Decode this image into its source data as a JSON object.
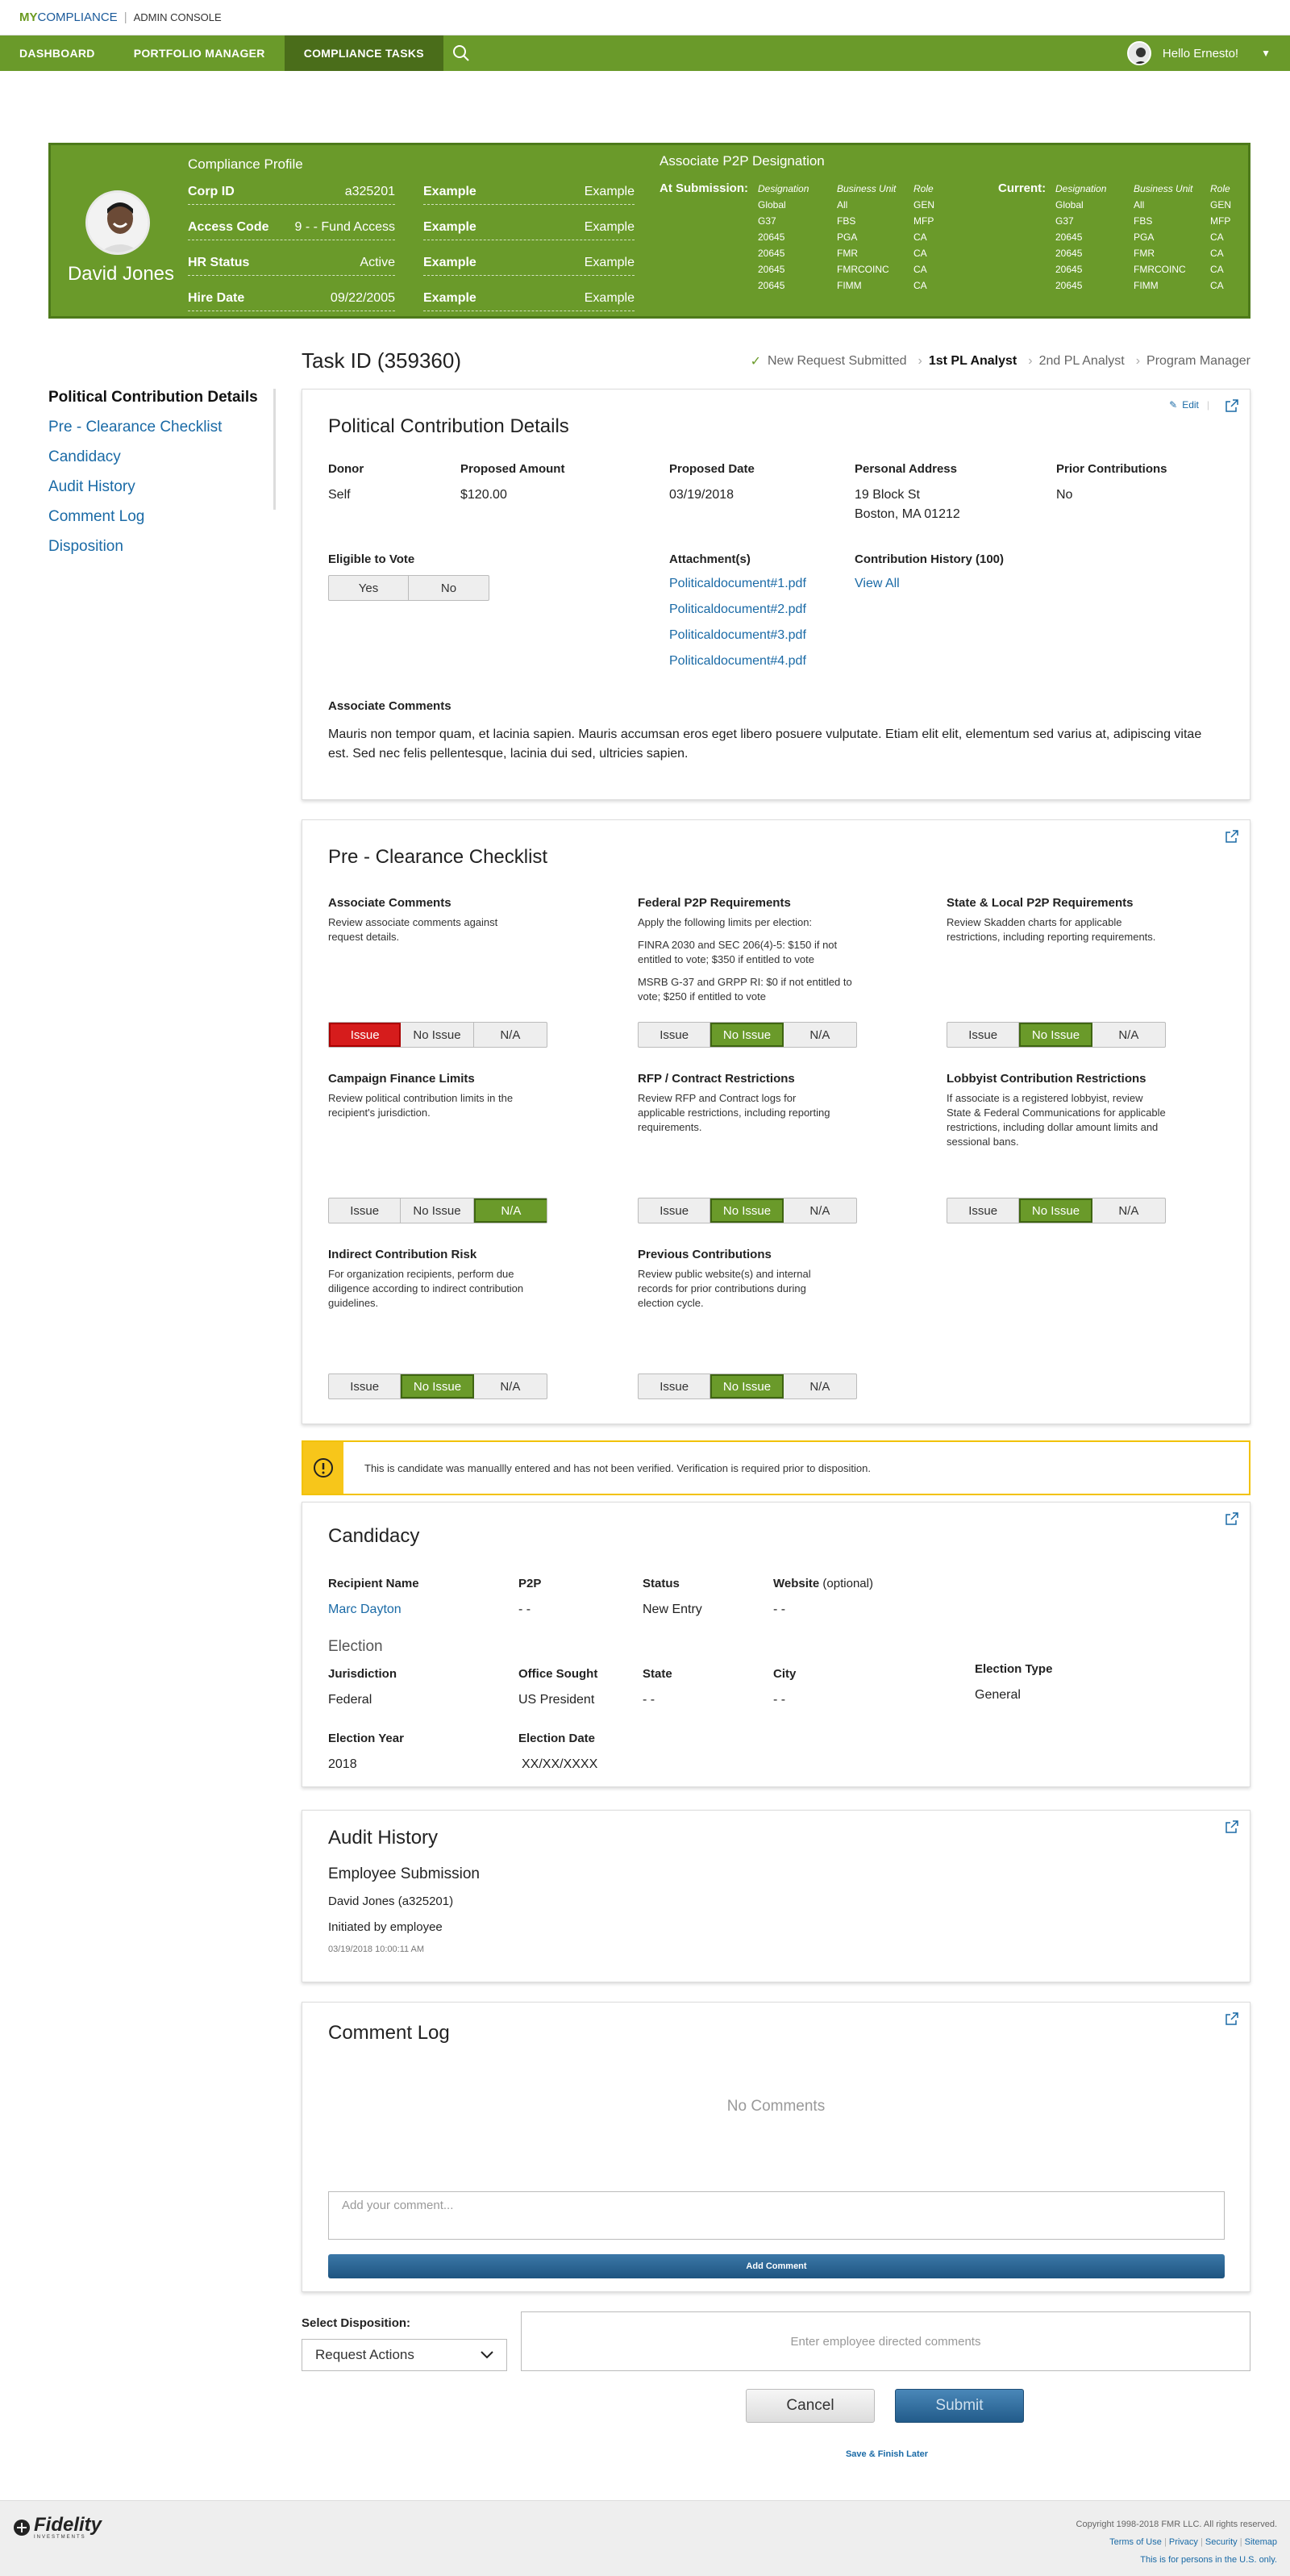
{
  "app": {
    "logo_my": "MY",
    "logo_compliance": "COMPLIANCE",
    "admin_console": "ADMIN CONSOLE"
  },
  "nav": {
    "items": [
      "DASHBOARD",
      "PORTFOLIO MANAGER",
      "COMPLIANCE TASKS"
    ],
    "user_greeting": "Hello Ernesto!"
  },
  "profile": {
    "name": "David Jones",
    "section_title": "Compliance Profile",
    "rows": [
      {
        "label": "Corp ID",
        "value": "a325201",
        "ex_label": "Example",
        "ex_value": "Example"
      },
      {
        "label": "Access Code",
        "value": "9 - - Fund Access",
        "ex_label": "Example",
        "ex_value": "Example"
      },
      {
        "label": "HR Status",
        "value": "Active",
        "ex_label": "Example",
        "ex_value": "Example"
      },
      {
        "label": "Hire Date",
        "value": "09/22/2005",
        "ex_label": "Example",
        "ex_value": "Example"
      }
    ],
    "p2p_title": "Associate P2P Designation",
    "at_submission_label": "At Submission:",
    "current_label": "Current:",
    "col_headers": [
      "Designation",
      "Business Unit",
      "Role"
    ],
    "designation": [
      "Global",
      "G37",
      "20645",
      "20645",
      "20645",
      "20645"
    ],
    "business_unit": [
      "All",
      "FBS",
      "PGA",
      "FMR",
      "FMRCOINC",
      "FIMM"
    ],
    "role": [
      "GEN",
      "MFP",
      "CA",
      "CA",
      "CA",
      "CA"
    ]
  },
  "task": {
    "id": "Task ID (359360)",
    "steps": [
      "New Request Submitted",
      "1st PL Analyst",
      "2nd PL Analyst",
      "Program Manager"
    ]
  },
  "sidenav": [
    "Political Contribution Details",
    "Pre - Clearance Checklist",
    "Candidacy",
    "Audit History",
    "Comment Log",
    "Disposition"
  ],
  "details": {
    "title": "Political Contribution Details",
    "edit": "Edit",
    "donor_label": "Donor",
    "donor": "Self",
    "amount_label": "Proposed Amount",
    "amount": "$120.00",
    "date_label": "Proposed Date",
    "date": "03/19/2018",
    "address_label": "Personal Address",
    "address1": "19 Block St",
    "address2": "Boston, MA 01212",
    "prior_label": "Prior Contributions",
    "prior": "No",
    "eligible_label": "Eligible to Vote",
    "yes": "Yes",
    "no": "No",
    "attachments_label": "Attachment(s)",
    "attachments": [
      "Politicaldocument#1.pdf",
      "Politicaldocument#2.pdf",
      "Politicaldocument#3.pdf",
      "Politicaldocument#4.pdf"
    ],
    "history_label": "Contribution History (100)",
    "view_all": "View All",
    "comments_label": "Associate Comments",
    "comments": "Mauris non tempor quam, et lacinia sapien. Mauris accumsan eros eget libero posuere vulputate. Etiam elit elit, elementum sed varius at, adipiscing vitae est. Sed nec felis pellentesque, lacinia dui sed, ultricies sapien."
  },
  "checklist": {
    "title": "Pre - Clearance Checklist",
    "labels": {
      "issue": "Issue",
      "no_issue": "No Issue",
      "na": "N/A"
    },
    "items": [
      {
        "title": "Associate Comments",
        "desc": "Review associate comments against request details.",
        "state": "issue"
      },
      {
        "title": "Federal P2P Requirements",
        "desc": "Apply the following limits per election:",
        "extra1": "FINRA 2030 and SEC 206(4)-5:  $150 if  not entitled  to vote; $350 if entitled to vote",
        "extra2": "MSRB G-37 and GRPP RI:  $0 if  not entitled  to vote; $250 if entitled to vote",
        "state": "no_issue"
      },
      {
        "title": "State & Local P2P Requirements",
        "desc": "Review Skadden charts for applicable restrictions, including reporting requirements.",
        "state": "no_issue"
      },
      {
        "title": "Campaign Finance Limits",
        "desc": "Review political contribution limits in the recipient's jurisdiction.",
        "state": "na"
      },
      {
        "title": "RFP / Contract Restrictions",
        "desc": "Review RFP and Contract logs for applicable restrictions, including reporting requirements.",
        "state": "no_issue"
      },
      {
        "title": "Lobbyist Contribution Restrictions",
        "desc": "If associate is a registered lobbyist, review State & Federal Communications for applicable restrictions, including dollar amount limits and sessional bans.",
        "state": "no_issue"
      },
      {
        "title": "Indirect Contribution Risk",
        "desc": "For organization recipients, perform due diligence according to indirect contribution guidelines.",
        "state": "no_issue"
      },
      {
        "title": "Previous Contributions",
        "desc": "Review public website(s) and internal records for prior contributions during election cycle.",
        "state": "no_issue"
      }
    ]
  },
  "warning": "This is candidate was manuallly entered and has not been verified. Verification is required prior to disposition.",
  "candidacy": {
    "title": "Candidacy",
    "recipient_label": "Recipient Name",
    "recipient": "Marc Dayton",
    "p2p_label": "P2P",
    "p2p": "- -",
    "status_label": "Status",
    "status": "New Entry",
    "website_label": "Website",
    "website_optional": "(optional)",
    "website": "- -",
    "election_heading": "Election",
    "jurisdiction_label": "Jurisdiction",
    "jurisdiction": "Federal",
    "office_label": "Office Sought",
    "office": "US President",
    "state_label": "State",
    "state": "- -",
    "city_label": "City",
    "city": "- -",
    "type_label": "Election Type",
    "type": "General",
    "year_label": "Election Year",
    "year": "2018",
    "edate_label": "Election Date",
    "edate": "XX/XX/XXXX"
  },
  "audit": {
    "title": "Audit History",
    "event": "Employee Submission",
    "who": "David Jones (a325201)",
    "action": "Initiated by employee",
    "time": "03/19/2018 10:00:11 AM"
  },
  "comment_log": {
    "title": "Comment Log",
    "empty": "No Comments",
    "placeholder": "Add your comment...",
    "add_button": "Add Comment"
  },
  "disposition": {
    "label": "Select Disposition:",
    "selected": "Request Actions",
    "comments_placeholder": "Enter employee directed comments",
    "cancel": "Cancel",
    "submit": "Submit",
    "save_later": "Save & Finish Later"
  },
  "footer": {
    "copyright": "Copyright 1998-2018 FMR LLC. All rights reserved.",
    "links": [
      "Terms of Use",
      "Privacy",
      "Security",
      "Sitemap"
    ],
    "note": "This is for persons in the U.S. only.",
    "logo": "Fidelity",
    "logo_sub": "INVESTMENTS"
  },
  "colors": {
    "brand_green": "#6a9a2a",
    "link_blue": "#1a6aa6",
    "issue_red": "#d61c1c",
    "warning_yellow": "#f7c61a"
  }
}
